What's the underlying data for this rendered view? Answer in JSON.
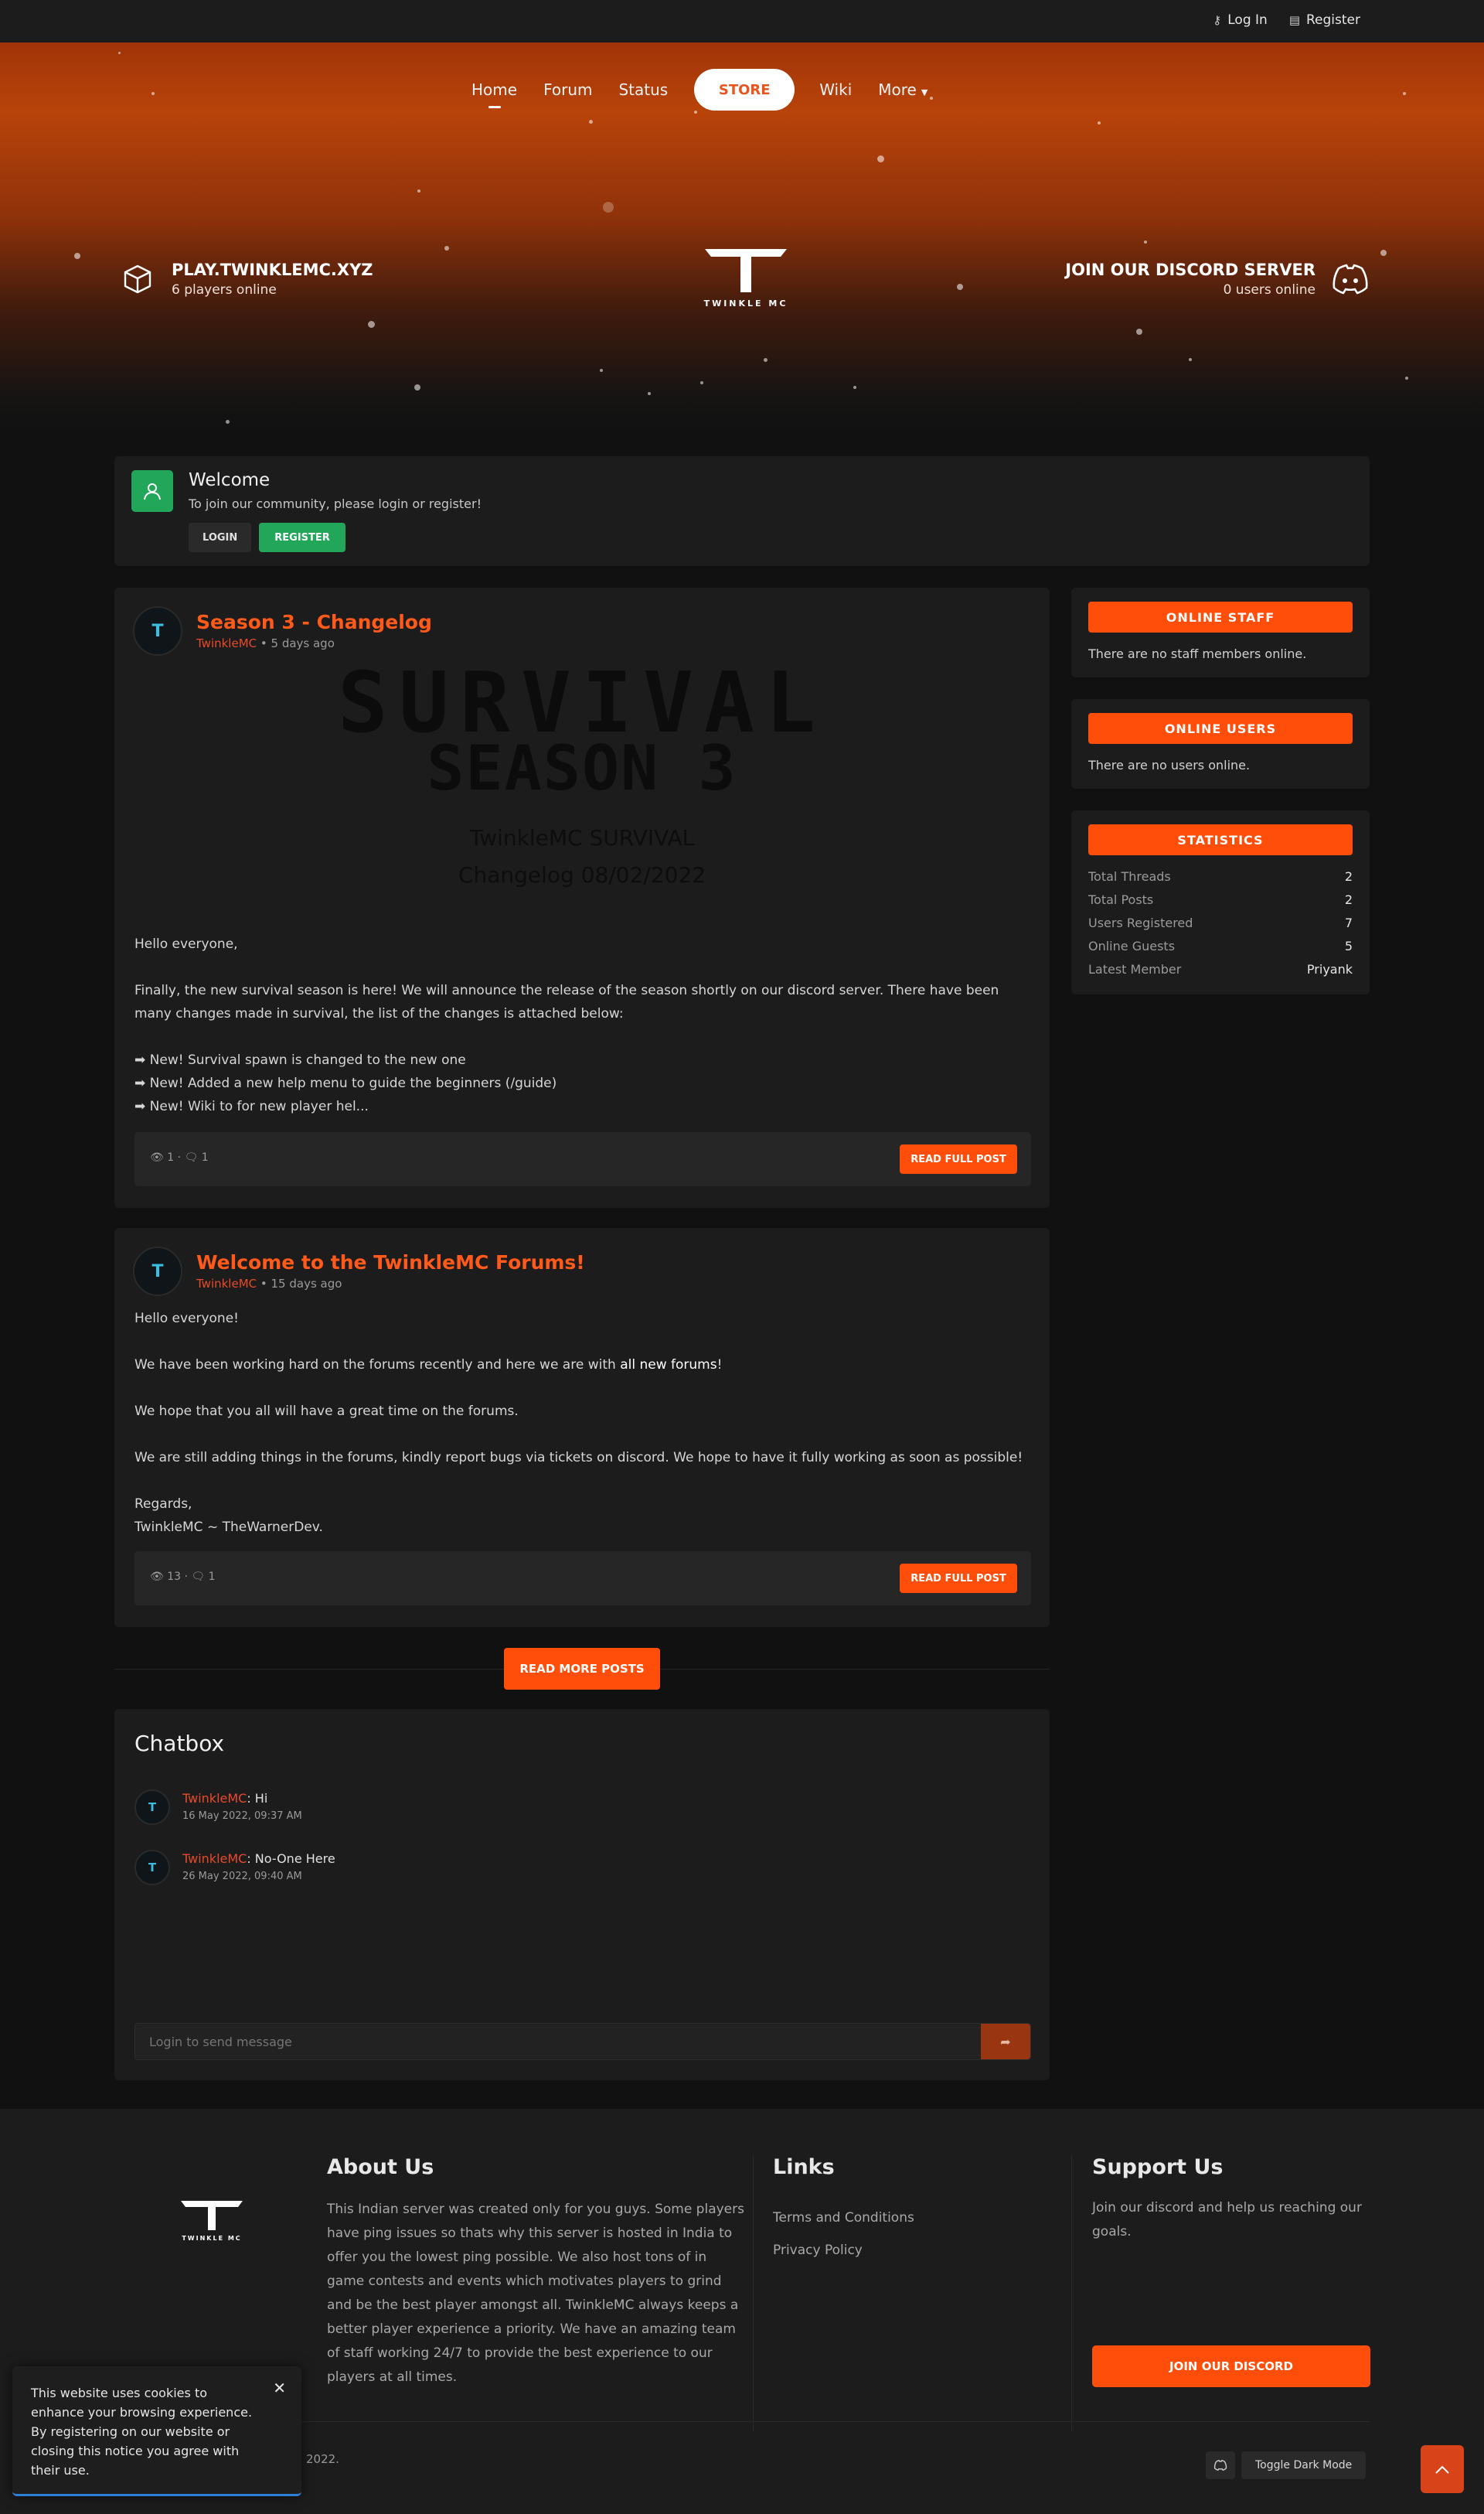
{
  "topbar": {
    "login": "Log In",
    "register": "Register"
  },
  "nav": {
    "home": "Home",
    "forum": "Forum",
    "status": "Status",
    "store": "STORE",
    "wiki": "Wiki",
    "more": "More"
  },
  "hero": {
    "server_ip": "PLAY.TWINKLEMC.XYZ",
    "players_online": "6 players online",
    "logo_text": "TWINKLE MC",
    "discord_title": "JOIN OUR DISCORD SERVER",
    "discord_users": "0 users online"
  },
  "welcome": {
    "title": "Welcome",
    "subtitle": "To join our community, please login or register!",
    "login": "LOGIN",
    "register": "REGISTER"
  },
  "posts": [
    {
      "title": "Season 3 - Changelog",
      "author": "TwinkleMC",
      "time": " • 5 days ago",
      "banner_line1": "SURVIVAL",
      "banner_line2": "SEASON 3",
      "banner_line3": "TwinkleMC SURVIVAL",
      "banner_line4": "Changelog 08/02/2022",
      "paragraphs": [
        "Hello everyone,",
        "Finally, the new survival season is here! We will announce the release of the season shortly on our discord server. There have been many changes made in survival, the list of the changes is attached below:"
      ],
      "list": [
        "➡ New! Survival spawn is changed to the new one",
        "➡ New! Added a new help menu to guide the beginners (/guide)",
        "➡ New! Wiki to for new player hel..."
      ],
      "views": "1",
      "comments": "1",
      "read_label": "READ FULL POST"
    },
    {
      "title": "Welcome to the TwinkleMC Forums!",
      "author": "TwinkleMC",
      "time": " • 15 days ago",
      "p1": "Hello everyone!",
      "p2_prefix": "We have been working hard on the forums recently and here we are with ",
      "p2_bold": "all new forums",
      "p2_suffix": "!",
      "p3": "We hope that you all will have a great time on the forums.",
      "p4": "We are still adding things in the forums, kindly report bugs via tickets on discord. We hope to have it fully working as soon as possible!",
      "p5a": "Regards,",
      "p5b": "TwinkleMC ~ TheWarnerDev.",
      "views": "13",
      "comments": "1",
      "read_label": "READ FULL POST"
    }
  ],
  "read_more": "READ MORE POSTS",
  "chatbox": {
    "title": "Chatbox",
    "messages": [
      {
        "user": "TwinkleMC",
        "text": ": Hi",
        "time": "16 May 2022, 09:37 AM"
      },
      {
        "user": "TwinkleMC",
        "text": ": No-One Here",
        "time": "26 May 2022, 09:40 AM"
      }
    ],
    "placeholder": "Login to send message"
  },
  "sidebar": {
    "staff_title": "ONLINE STAFF",
    "staff_text": "There are no staff members online.",
    "users_title": "ONLINE USERS",
    "users_text": "There are no users online.",
    "stats_title": "STATISTICS",
    "stats": [
      {
        "label": "Total Threads",
        "value": "2"
      },
      {
        "label": "Total Posts",
        "value": "2"
      },
      {
        "label": "Users Registered",
        "value": "7"
      },
      {
        "label": "Online Guests",
        "value": "5"
      },
      {
        "label": "Latest Member",
        "value": "Priyank"
      }
    ]
  },
  "footer": {
    "logo_text": "TWINKLE MC",
    "about_title": "About Us",
    "about_text": "This Indian server was created only for you guys. Some players have ping issues so thats why this server is hosted in India to offer you the lowest ping possible. We also host tons of in game contests and events which motivates players to grind and be the best player amongst all. TwinkleMC always keeps a better player experience a priority. We have an amazing team of staff working 24/7 to provide the best experience to our players at all times.",
    "links_title": "Links",
    "link1": "Terms and Conditions",
    "link2": "Privacy Policy",
    "support_title": "Support Us",
    "support_text": "Join our discord and help us reaching our goals.",
    "support_button": "JOIN OUR DISCORD",
    "copyright": "2022.",
    "dark_toggle": "Toggle Dark Mode"
  },
  "cookie": {
    "text": "This website uses cookies to enhance your browsing experience. By registering on our website or closing this notice you agree with their use."
  },
  "colors": {
    "accent": "#ff4d0a",
    "green": "#22a65a",
    "username": "#e84a2a"
  },
  "icons": [
    "login-icon",
    "register-icon",
    "cube-icon",
    "discord-icon",
    "user-icon",
    "eye-icon",
    "comment-icon",
    "send-icon",
    "close-icon",
    "arrow-up-icon"
  ]
}
